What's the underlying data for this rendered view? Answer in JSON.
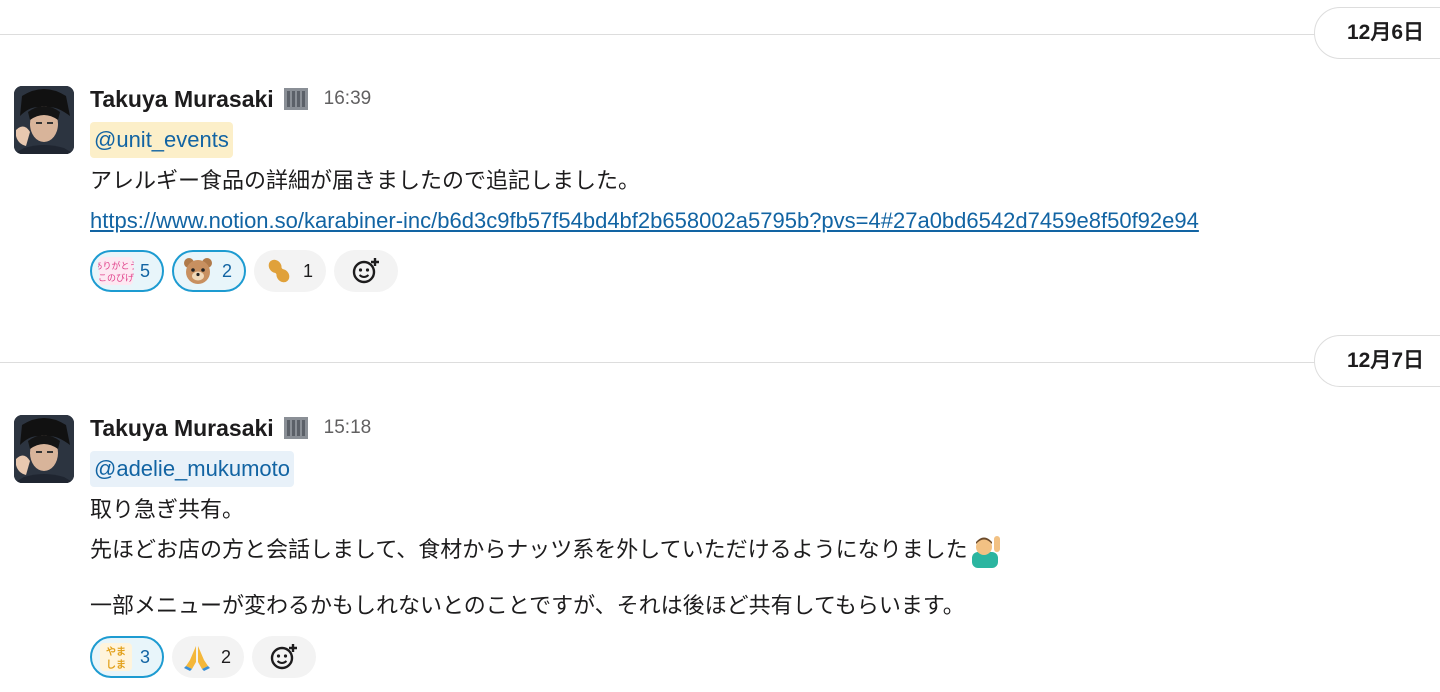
{
  "dividers": [
    {
      "date": "12月6日"
    },
    {
      "date": "12月7日"
    }
  ],
  "messages": [
    {
      "sender": "Takuya Murasaki",
      "time": "16:39",
      "mention": "@unit_events",
      "lines": [
        "アレルギー食品の詳細が届きましたので追記しました。"
      ],
      "link": "https://www.notion.so/karabiner-inc/b6d3c9fb57f54bd4bf2b658002a5795b?pvs=4#27a0bd6542d7459e8f50f92e94",
      "reactions": [
        {
          "emoji": "arigato-konobi-sticker",
          "count": "5",
          "selected": true
        },
        {
          "emoji": "bear-face",
          "count": "2",
          "selected": true
        },
        {
          "emoji": "peanut",
          "count": "1",
          "selected": false
        }
      ]
    },
    {
      "sender": "Takuya Murasaki",
      "time": "15:18",
      "mention": "@adelie_mukumoto",
      "lines": [
        "取り急ぎ共有。",
        "先ほどお店の方と会話しまして、食材からナッツ系を外していただけるようになりました",
        "一部メニューが変わるかもしれないとのことですが、それは後ほど共有してもらいます。"
      ],
      "reactions": [
        {
          "emoji": "yoroshiku-sticker",
          "count": "3",
          "selected": true
        },
        {
          "emoji": "folded-hands",
          "count": "2",
          "selected": false
        }
      ]
    }
  ],
  "colors": {
    "link": "#1264a3",
    "mention_highlight_bg": "#fcefc9",
    "mention_bg": "#e8f1f9",
    "reaction_selected_border": "#1d9bd1",
    "reaction_selected_bg": "#e8f5fa"
  }
}
